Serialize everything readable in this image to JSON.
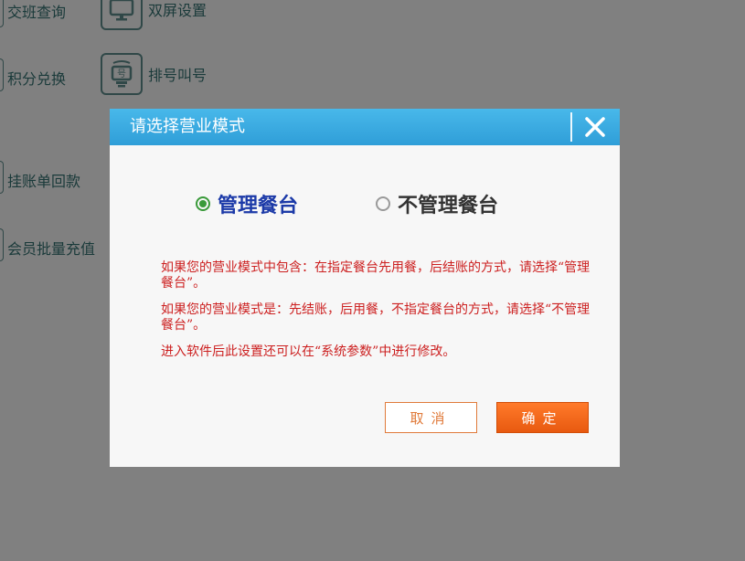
{
  "background": {
    "items": [
      {
        "label": "交班查询"
      },
      {
        "label": "双屏设置"
      },
      {
        "label": "积分兑换"
      },
      {
        "label": "排号叫号"
      },
      {
        "label": "挂账单回款"
      },
      {
        "label": "会员批量充值"
      }
    ]
  },
  "modal": {
    "title": "请选择营业模式",
    "options": [
      {
        "label": "管理餐台",
        "selected": true
      },
      {
        "label": "不管理餐台",
        "selected": false
      }
    ],
    "info": [
      "如果您的营业模式中包含：在指定餐台先用餐，后结账的方式，请选择“管理餐台”。",
      "如果您的营业模式是：先结账，后用餐，不指定餐台的方式，请选择“不管理餐台”。",
      "进入软件后此设置还可以在“系统参数”中进行修改。"
    ],
    "cancel_label": "取消",
    "ok_label": "确定"
  },
  "colors": {
    "header": "#2f9ed8",
    "selected_text": "#1c3aa8",
    "info_text": "#cc1f1f",
    "accent": "#e85a10",
    "radio_selected": "#3a9a3a"
  },
  "icons": {
    "close": "close-icon",
    "monitor": "monitor-icon",
    "ticket": "queue-ticket-icon"
  }
}
